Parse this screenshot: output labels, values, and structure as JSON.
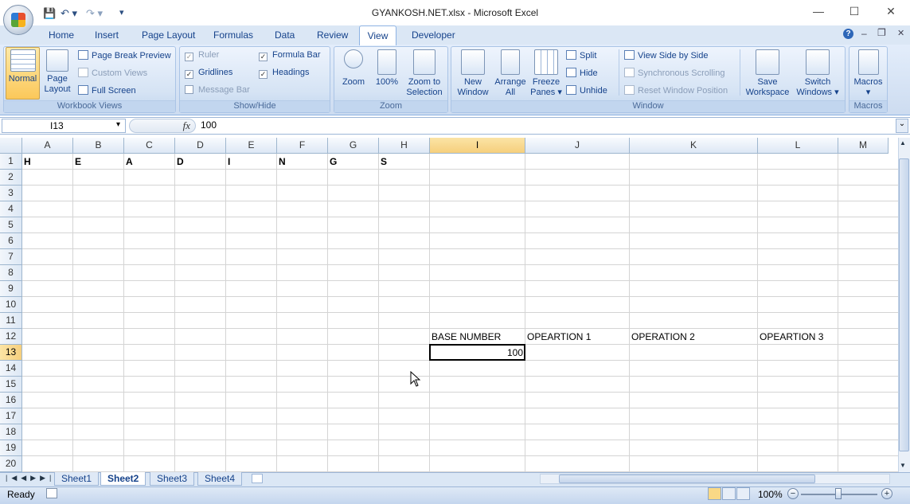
{
  "window": {
    "title": "GYANKOSH.NET.xlsx - Microsoft Excel",
    "min": "—",
    "max": "☐",
    "close": "✕"
  },
  "qat": {
    "save": "💾",
    "undo": "↶ ▾",
    "redo": "↷ ▾",
    "customize": "▾"
  },
  "tabs": [
    "Home",
    "Insert",
    "Page Layout",
    "Formulas",
    "Data",
    "Review",
    "View",
    "Developer"
  ],
  "active_tab": "View",
  "ribbon_right": {
    "help": "?",
    "min": "–",
    "restore": "❐",
    "close": "✕"
  },
  "groups": {
    "workbook_views": {
      "label": "Workbook Views",
      "normal": "Normal",
      "page_layout": "Page Layout",
      "page_break": "Page Break Preview",
      "custom_views": "Custom Views",
      "full_screen": "Full Screen"
    },
    "show_hide": {
      "label": "Show/Hide",
      "ruler": "Ruler",
      "gridlines": "Gridlines",
      "message_bar": "Message Bar",
      "formula_bar": "Formula Bar",
      "headings": "Headings"
    },
    "zoom": {
      "label": "Zoom",
      "zoom": "Zoom",
      "hundred": "100%",
      "zoom_sel": "Zoom to Selection"
    },
    "window": {
      "label": "Window",
      "new_window": "New Window",
      "arrange": "Arrange All",
      "freeze": "Freeze Panes ▾",
      "split": "Split",
      "hide": "Hide",
      "unhide": "Unhide",
      "side_by_side": "View Side by Side",
      "sync": "Synchronous Scrolling",
      "reset": "Reset Window Position",
      "save_ws": "Save Workspace",
      "switch": "Switch Windows ▾"
    },
    "macros": {
      "label": "Macros",
      "macros": "Macros",
      "arrow": "▾"
    }
  },
  "formula_bar": {
    "name_box": "I13",
    "fx": "fx",
    "value": "100",
    "dropdown": "▾",
    "expand": "⌄"
  },
  "columns": [
    "A",
    "B",
    "C",
    "D",
    "E",
    "F",
    "G",
    "H",
    "I",
    "J",
    "K",
    "L",
    "M"
  ],
  "rows": [
    "1",
    "2",
    "3",
    "4",
    "5",
    "6",
    "7",
    "8",
    "9",
    "10",
    "11",
    "12",
    "13",
    "14",
    "15",
    "16",
    "17",
    "18",
    "19",
    "20"
  ],
  "cells": {
    "A1": "H",
    "B1": "E",
    "C1": "A",
    "D1": "D",
    "E1": "I",
    "F1": "N",
    "G1": "G",
    "H1": "S",
    "I12": "BASE NUMBER",
    "J12": "OPEARTION 1",
    "K12": "OPERATION 2",
    "L12": "OPEARTION 3",
    "I13": "100"
  },
  "sheets": [
    "Sheet1",
    "Sheet2",
    "Sheet3",
    "Sheet4"
  ],
  "active_sheet": "Sheet2",
  "status": {
    "text": "Ready",
    "zoom": "100%",
    "minus": "−",
    "plus": "+"
  }
}
